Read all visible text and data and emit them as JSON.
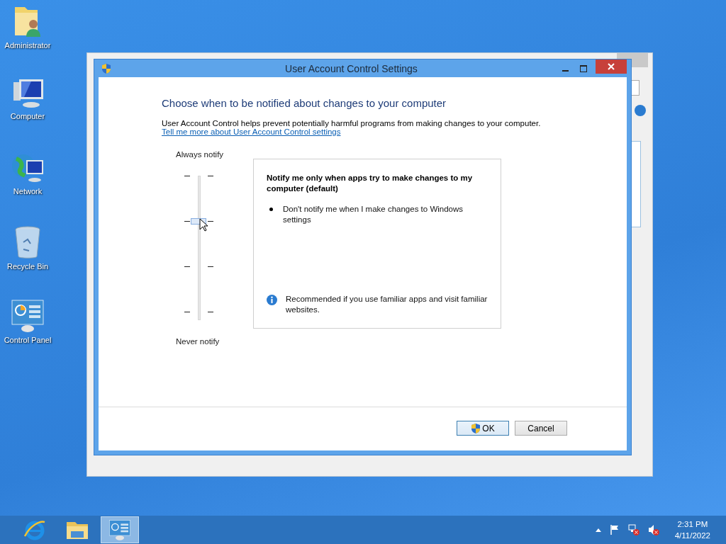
{
  "desktop_icons": [
    {
      "kind": "user-folder",
      "label": "Administrator"
    },
    {
      "kind": "computer",
      "label": "Computer"
    },
    {
      "kind": "network",
      "label": "Network"
    },
    {
      "kind": "recycle-bin",
      "label": "Recycle Bin"
    },
    {
      "kind": "control-panel",
      "label": "Control Panel"
    }
  ],
  "window": {
    "title": "User Account Control Settings"
  },
  "heading": "Choose when to be notified about changes to your computer",
  "description": "User Account Control helps prevent potentially harmful programs from making changes to your computer.",
  "link": "Tell me more about User Account Control settings",
  "slider": {
    "top_label": "Always notify",
    "bottom_label": "Never notify",
    "level": 0.667
  },
  "info_panel": {
    "title": "Notify me only when apps try to make changes to my computer (default)",
    "bullets": [
      "Don't notify me when I make changes to Windows settings"
    ],
    "note": "Recommended if you use familiar apps and visit familiar websites."
  },
  "buttons": [
    {
      "kind": "shield",
      "label": "OK"
    },
    {
      "kind": "plain",
      "label": "Cancel"
    }
  ],
  "taskbar": {
    "apps": [
      {
        "kind": "browser",
        "selected": false
      },
      {
        "kind": "explorer",
        "selected": false
      },
      {
        "kind": "control-panel",
        "selected": true
      }
    ],
    "clock": {
      "time": "2:31 PM",
      "date": "4/11/2022"
    }
  }
}
